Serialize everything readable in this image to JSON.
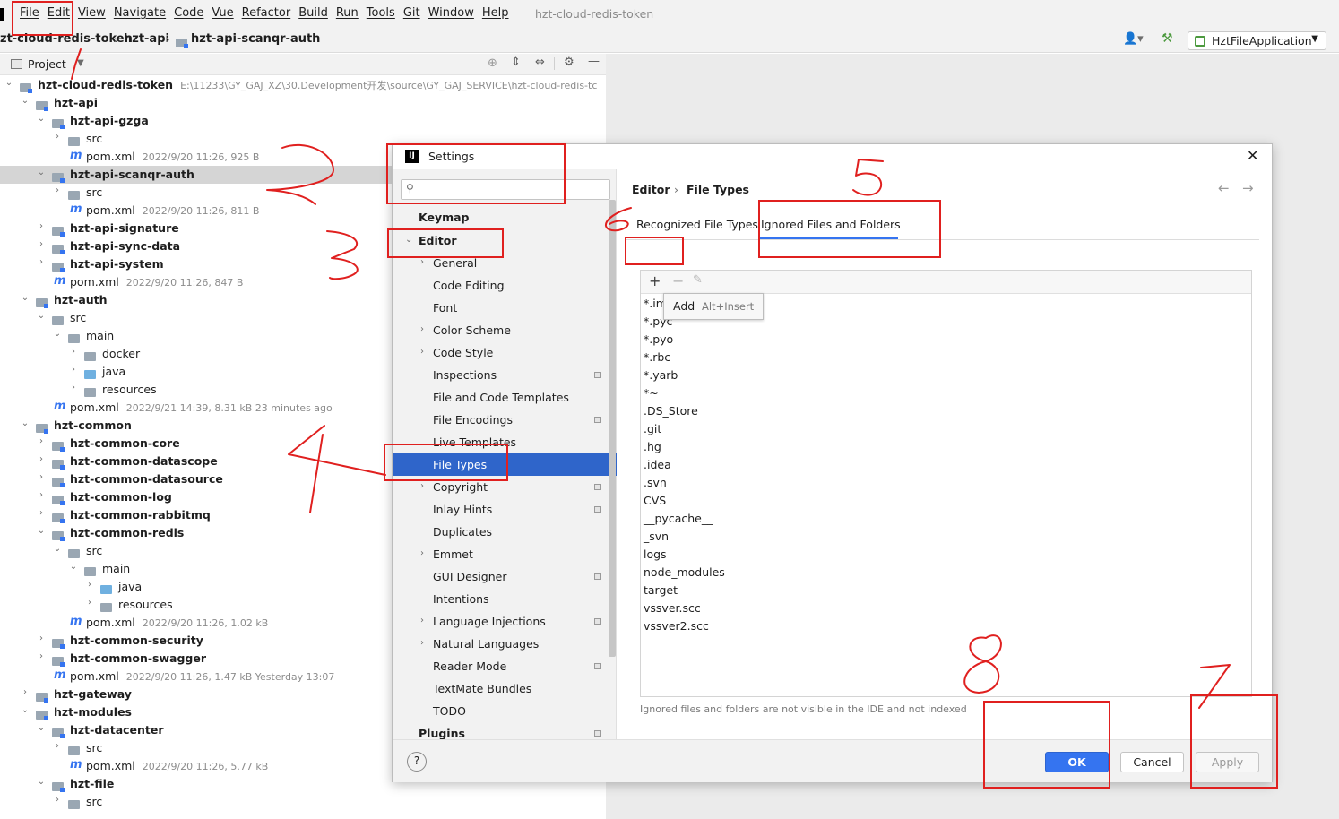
{
  "menubar": {
    "items": [
      "File",
      "Edit",
      "View",
      "Navigate",
      "Code",
      "Vue",
      "Refactor",
      "Build",
      "Run",
      "Tools",
      "Git",
      "Window",
      "Help"
    ],
    "window_title": "hzt-cloud-redis-token"
  },
  "navbar": {
    "crumbs": [
      "zt-cloud-redis-token",
      "hzt-api",
      "hzt-api-scanqr-auth"
    ],
    "run_config": "HztFileApplication"
  },
  "project_panel": {
    "title": "Project",
    "tree": [
      {
        "label": "hzt-cloud-redis-token",
        "meta": "E:\\11233\\GY_GAJ_XZ\\30.Development开发\\source\\GY_GAJ_SERVICE\\hzt-cloud-redis-tc",
        "bold": true
      },
      {
        "label": "hzt-api",
        "meta": "",
        "bold": true
      },
      {
        "label": "hzt-api-gzga",
        "meta": "",
        "bold": true
      },
      {
        "label": "src",
        "meta": "",
        "bold": false
      },
      {
        "label": "pom.xml",
        "meta": "2022/9/20 11:26, 925 B",
        "bold": false
      },
      {
        "label": "hzt-api-scanqr-auth",
        "meta": "",
        "bold": true
      },
      {
        "label": "src",
        "meta": "",
        "bold": false
      },
      {
        "label": "pom.xml",
        "meta": "2022/9/20 11:26, 811 B",
        "bold": false
      },
      {
        "label": "hzt-api-signature",
        "meta": "",
        "bold": true
      },
      {
        "label": "hzt-api-sync-data",
        "meta": "",
        "bold": true
      },
      {
        "label": "hzt-api-system",
        "meta": "",
        "bold": true
      },
      {
        "label": "pom.xml",
        "meta": "2022/9/20 11:26, 847 B",
        "bold": false
      },
      {
        "label": "hzt-auth",
        "meta": "",
        "bold": true
      },
      {
        "label": "src",
        "meta": "",
        "bold": false
      },
      {
        "label": "main",
        "meta": "",
        "bold": false
      },
      {
        "label": "docker",
        "meta": "",
        "bold": false
      },
      {
        "label": "java",
        "meta": "",
        "bold": false
      },
      {
        "label": "resources",
        "meta": "",
        "bold": false
      },
      {
        "label": "pom.xml",
        "meta": "2022/9/21 14:39, 8.31 kB 23 minutes ago",
        "bold": false
      },
      {
        "label": "hzt-common",
        "meta": "",
        "bold": true
      },
      {
        "label": "hzt-common-core",
        "meta": "",
        "bold": true
      },
      {
        "label": "hzt-common-datascope",
        "meta": "",
        "bold": true
      },
      {
        "label": "hzt-common-datasource",
        "meta": "",
        "bold": true
      },
      {
        "label": "hzt-common-log",
        "meta": "",
        "bold": true
      },
      {
        "label": "hzt-common-rabbitmq",
        "meta": "",
        "bold": true
      },
      {
        "label": "hzt-common-redis",
        "meta": "",
        "bold": true
      },
      {
        "label": "src",
        "meta": "",
        "bold": false
      },
      {
        "label": "main",
        "meta": "",
        "bold": false
      },
      {
        "label": "java",
        "meta": "",
        "bold": false
      },
      {
        "label": "resources",
        "meta": "",
        "bold": false
      },
      {
        "label": "pom.xml",
        "meta": "2022/9/20 11:26, 1.02 kB",
        "bold": false
      },
      {
        "label": "hzt-common-security",
        "meta": "",
        "bold": true
      },
      {
        "label": "hzt-common-swagger",
        "meta": "",
        "bold": true
      },
      {
        "label": "pom.xml",
        "meta": "2022/9/20 11:26, 1.47 kB Yesterday 13:07",
        "bold": false
      },
      {
        "label": "hzt-gateway",
        "meta": "",
        "bold": true
      },
      {
        "label": "hzt-modules",
        "meta": "",
        "bold": true
      },
      {
        "label": "hzt-datacenter",
        "meta": "",
        "bold": true
      },
      {
        "label": "src",
        "meta": "",
        "bold": false
      },
      {
        "label": "pom.xml",
        "meta": "2022/9/20 11:26, 5.77 kB",
        "bold": false
      },
      {
        "label": "hzt-file",
        "meta": "",
        "bold": true
      },
      {
        "label": "src",
        "meta": "",
        "bold": false
      }
    ]
  },
  "dialog": {
    "title": "Settings",
    "search_placeholder": "",
    "tree": [
      {
        "label": "Keymap"
      },
      {
        "label": "Editor"
      },
      {
        "label": "General"
      },
      {
        "label": "Code Editing"
      },
      {
        "label": "Font"
      },
      {
        "label": "Color Scheme"
      },
      {
        "label": "Code Style"
      },
      {
        "label": "Inspections"
      },
      {
        "label": "File and Code Templates"
      },
      {
        "label": "File Encodings"
      },
      {
        "label": "Live Templates"
      },
      {
        "label": "File Types"
      },
      {
        "label": "Copyright"
      },
      {
        "label": "Inlay Hints"
      },
      {
        "label": "Duplicates"
      },
      {
        "label": "Emmet"
      },
      {
        "label": "GUI Designer"
      },
      {
        "label": "Intentions"
      },
      {
        "label": "Language Injections"
      },
      {
        "label": "Natural Languages"
      },
      {
        "label": "Reader Mode"
      },
      {
        "label": "TextMate Bundles"
      },
      {
        "label": "TODO"
      },
      {
        "label": "Plugins"
      }
    ],
    "breadcrumb": [
      "Editor",
      "File Types"
    ],
    "tabs": [
      "Recognized File Types",
      "Ignored Files and Folders"
    ],
    "tooltip": {
      "label": "Add",
      "shortcut": "Alt+Insert"
    },
    "ignored_list": [
      "*.im",
      "*.pyc",
      "*.pyo",
      "*.rbc",
      "*.yarb",
      "*~",
      ".DS_Store",
      ".git",
      ".hg",
      ".idea",
      ".svn",
      "CVS",
      "__pycache__",
      "_svn",
      "logs",
      "node_modules",
      "target",
      "vssver.scc",
      "vssver2.scc"
    ],
    "hint": "Ignored files and folders are not visible in the IDE and not indexed",
    "buttons": {
      "ok": "OK",
      "cancel": "Cancel",
      "apply": "Apply",
      "help": "?"
    }
  },
  "colors": {
    "selection": "#2f65ca",
    "primary_button": "#3574f0",
    "annotation": "#e0201f"
  }
}
